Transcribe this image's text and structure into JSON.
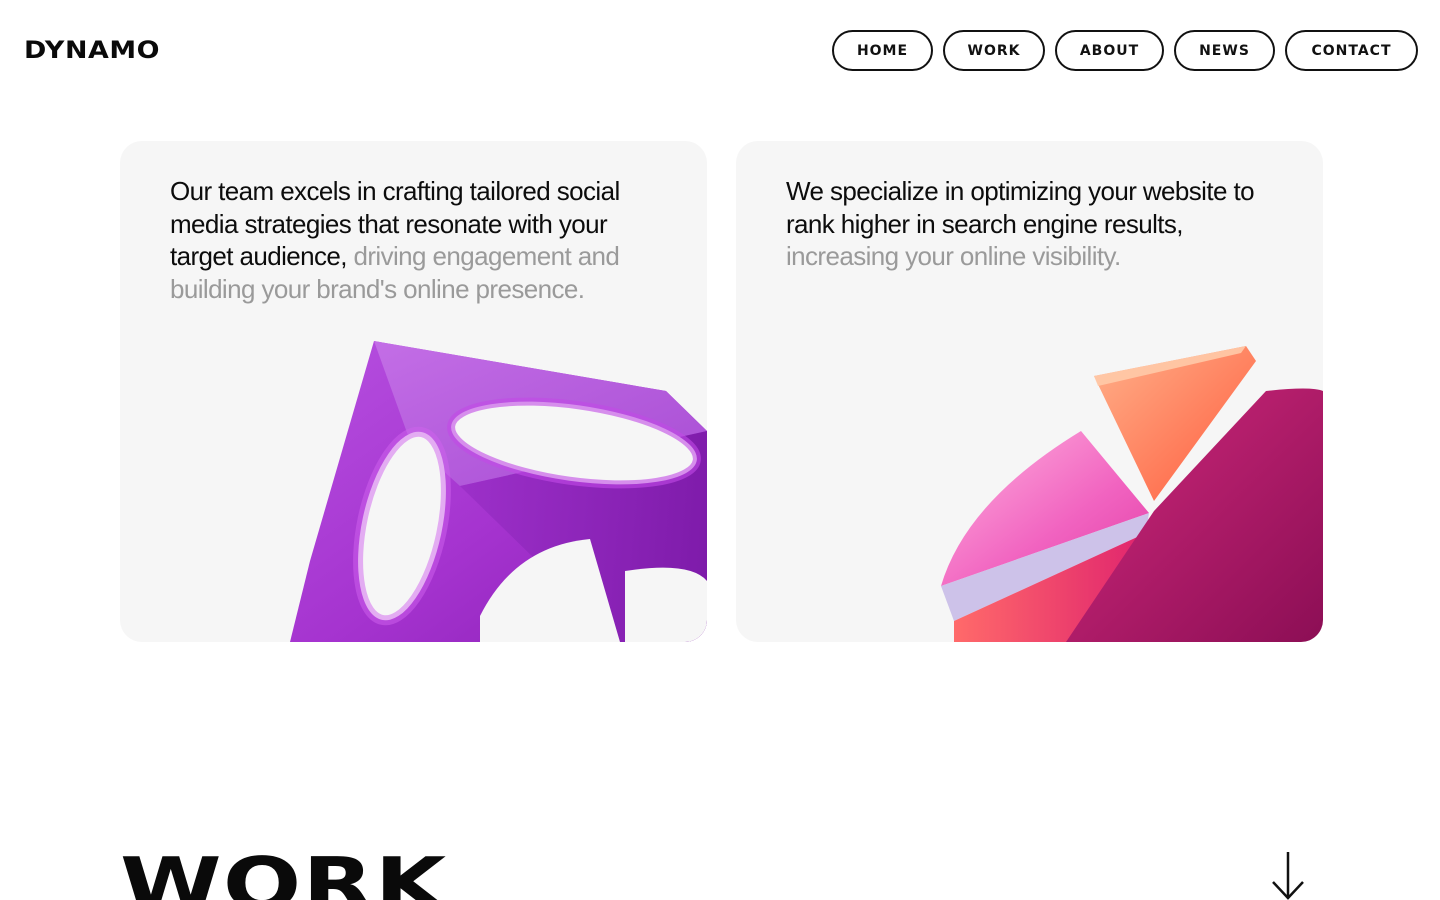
{
  "header": {
    "logo": "DYNAMO",
    "nav": [
      "HOME",
      "WORK",
      "ABOUT",
      "NEWS",
      "CONTACT"
    ]
  },
  "cards": [
    {
      "text_dark": "Our team excels in crafting tailored social media strategies that resonate with your target audience,",
      "text_muted": " driving engagement and building your brand's online presence.",
      "art_icon": "purple-glass-cube-icon"
    },
    {
      "text_dark": "We specialize in optimizing your website to rank higher in search engine results,",
      "text_muted": " increasing your online visibility.",
      "art_icon": "pie-chart-3d-icon"
    }
  ],
  "work_section": {
    "title": "WORK",
    "arrow_icon": "arrow-down-icon"
  },
  "colors": {
    "card_background": "#f6f6f6",
    "muted_text": "#9a9a9a",
    "purple": "#a23bd0",
    "magenta": "#c6196f",
    "orange": "#ff8a5b"
  }
}
